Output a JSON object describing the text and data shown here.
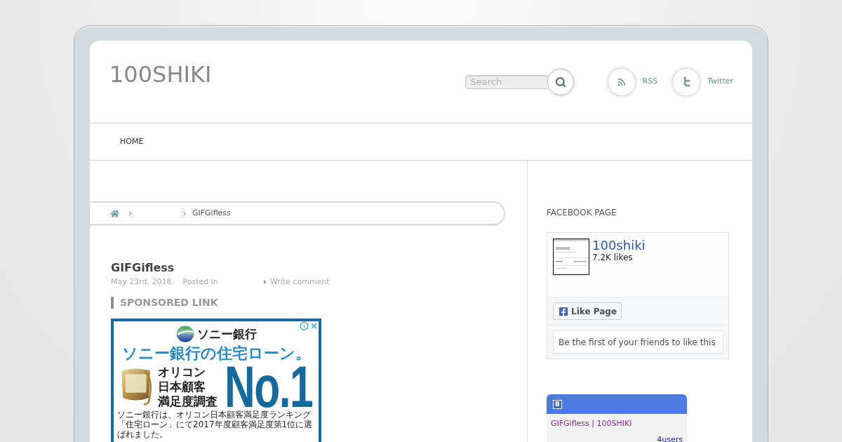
{
  "header": {
    "site_title": "100SHIKI",
    "search": {
      "placeholder": "Search"
    },
    "social_links": [
      {
        "kind": "rss",
        "label": "RSS"
      },
      {
        "kind": "twitter",
        "label": "Twitter"
      }
    ]
  },
  "nav": {
    "items": [
      {
        "label": "HOME"
      }
    ]
  },
  "breadcrumb": {
    "current": "GIFGifless"
  },
  "post": {
    "title": "GIFGifless",
    "date": "May 23rd, 2018",
    "posted_in": "Posted in",
    "comment_link": "Write comment"
  },
  "sponsored": {
    "heading": "SPONSORED LINK",
    "ad": {
      "brand": "ソニー銀行",
      "headline": "ソニー銀行の住宅ローン。",
      "award_lines": [
        "オリコン",
        "日本顧客",
        "満足度調査"
      ],
      "rank": "No.1",
      "footnote_lines": [
        "ソニー銀行は、オリコン日本顧客満足度ランキング",
        "「住宅ローン」にて2017年度顧客満足度第1位に選ばれました。"
      ]
    }
  },
  "sidebar": {
    "facebook": {
      "heading": "FACEBOOK PAGE",
      "page_name": "100shiki",
      "likes": "7.2K likes",
      "like_button": "Like Page",
      "friends_note": "Be the first of your friends to like this"
    },
    "bookmark_widget": {
      "badge": "B",
      "title": "GIFGifless | 100SHIKI",
      "count": "4users"
    }
  }
}
